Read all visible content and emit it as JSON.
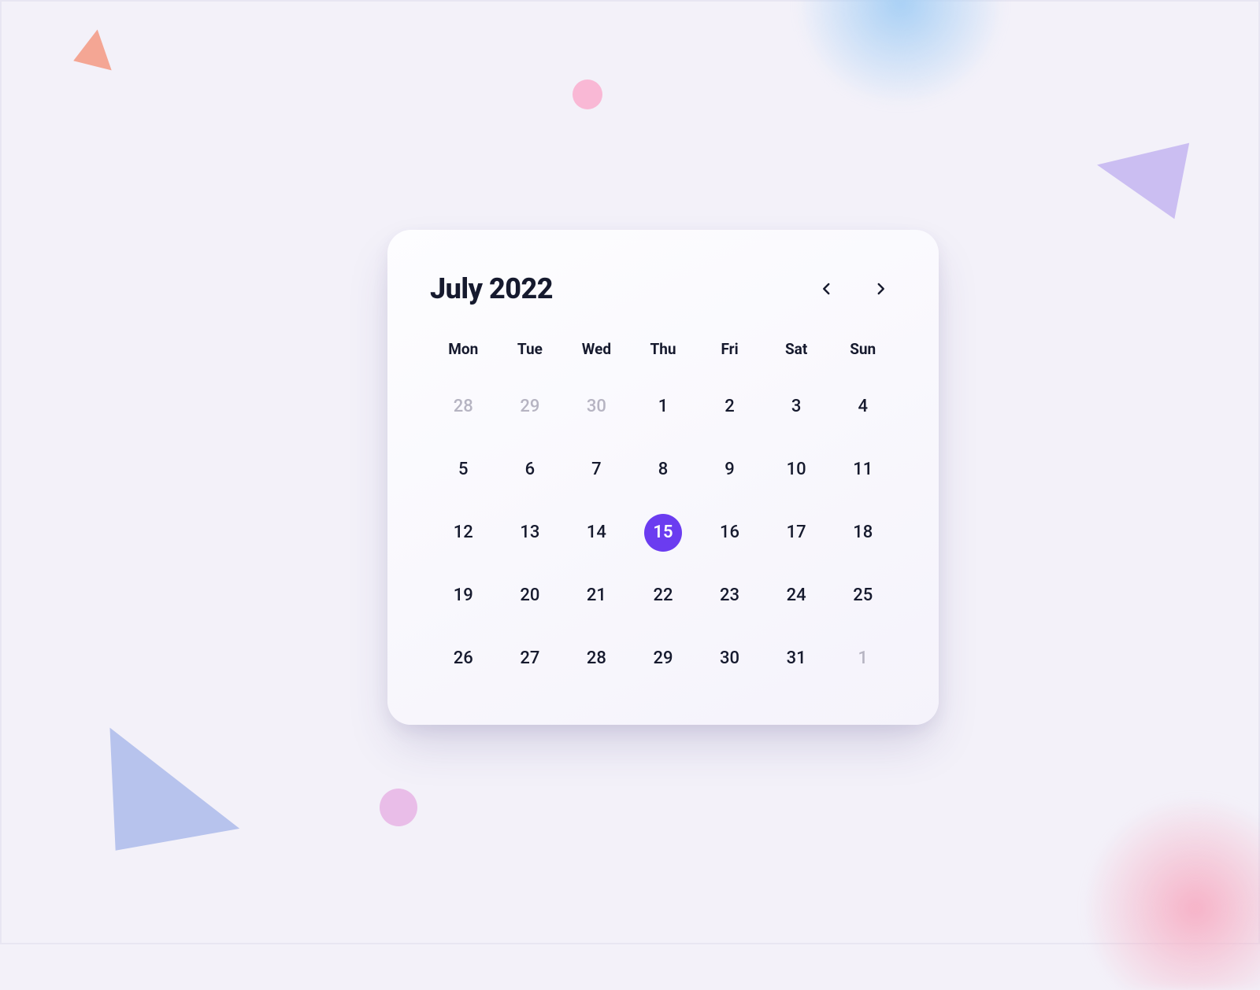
{
  "calendar": {
    "title": "July 2022",
    "weekdays": [
      "Mon",
      "Tue",
      "Wed",
      "Thu",
      "Fri",
      "Sat",
      "Sun"
    ],
    "selected_day": 15,
    "weeks": [
      [
        {
          "n": "28",
          "muted": true
        },
        {
          "n": "29",
          "muted": true
        },
        {
          "n": "30",
          "muted": true
        },
        {
          "n": "1"
        },
        {
          "n": "2"
        },
        {
          "n": "3"
        },
        {
          "n": "4"
        }
      ],
      [
        {
          "n": "5"
        },
        {
          "n": "6"
        },
        {
          "n": "7"
        },
        {
          "n": "8"
        },
        {
          "n": "9"
        },
        {
          "n": "10"
        },
        {
          "n": "11"
        }
      ],
      [
        {
          "n": "12"
        },
        {
          "n": "13"
        },
        {
          "n": "14"
        },
        {
          "n": "15",
          "selected": true
        },
        {
          "n": "16"
        },
        {
          "n": "17"
        },
        {
          "n": "18"
        }
      ],
      [
        {
          "n": "19"
        },
        {
          "n": "20"
        },
        {
          "n": "21"
        },
        {
          "n": "22"
        },
        {
          "n": "23"
        },
        {
          "n": "24"
        },
        {
          "n": "25"
        }
      ],
      [
        {
          "n": "26"
        },
        {
          "n": "27"
        },
        {
          "n": "28"
        },
        {
          "n": "29"
        },
        {
          "n": "30"
        },
        {
          "n": "31"
        },
        {
          "n": "1",
          "muted": true
        }
      ]
    ]
  },
  "colors": {
    "accent": "#6b3cf0",
    "text": "#161a2e",
    "muted": "#b6b4c2",
    "card_bg_start": "#fdfdff",
    "card_bg_end": "#f5f3fb",
    "page_bg": "#f3f1f9"
  }
}
